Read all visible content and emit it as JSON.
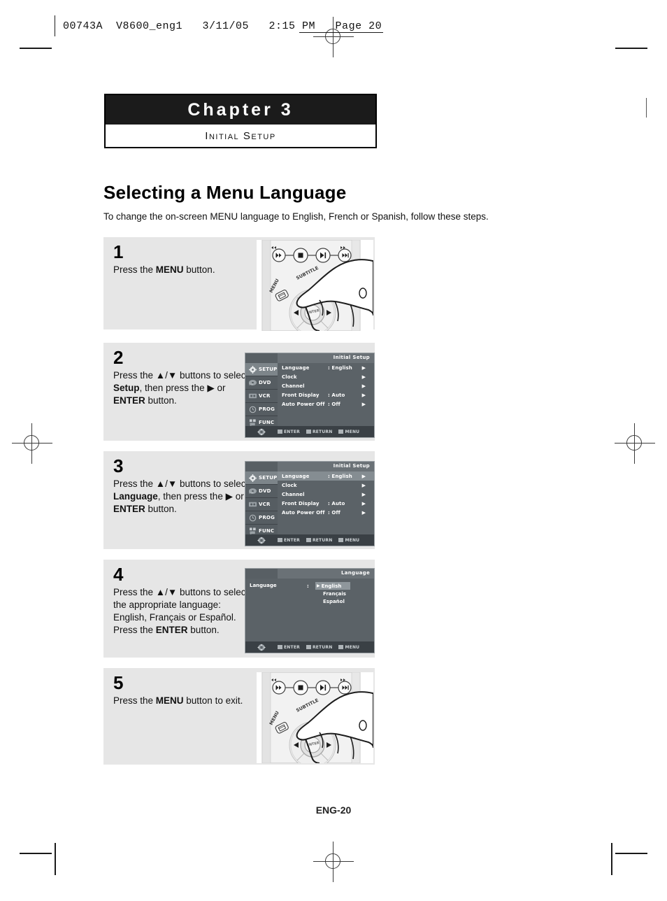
{
  "page": {
    "slug": "00743A  V8600_eng1   3/11/05   2:15 PM   Page 20",
    "footer": "ENG-20"
  },
  "chapter": {
    "title": "Chapter 3",
    "subtitle": "Initial Setup"
  },
  "section": {
    "title": "Selecting a Menu Language",
    "intro": "To change the on-screen MENU language to English, French or Spanish, follow these steps."
  },
  "steps": [
    {
      "number": "1",
      "text_html": "Press the <b>MENU</b> button.",
      "graphic": "remote"
    },
    {
      "number": "2",
      "text_html": "Press the ▲/▼ buttons to select <b>Setup</b>, then press the ▶ or <b>ENTER</b> button.",
      "graphic": "osd-setup"
    },
    {
      "number": "3",
      "text_html": "Press the ▲/▼ buttons to select <b>Language</b>, then press the ▶ or <b>ENTER</b> button.",
      "graphic": "osd-setup-highlight"
    },
    {
      "number": "4",
      "text_html": "Press the ▲/▼ buttons to select the appropriate language: English, Français or Español.<br>Press the <b>ENTER</b> button.",
      "graphic": "osd-language"
    },
    {
      "number": "5",
      "text_html": "Press the <b>MENU</b> button to exit.",
      "graphic": "remote"
    }
  ],
  "osd": {
    "title": "Initial Setup",
    "language_title": "Language",
    "tabs": [
      {
        "label": "SETUP",
        "icon": "gear-icon",
        "selected": true
      },
      {
        "label": "DVD",
        "icon": "disc-icon",
        "selected": false
      },
      {
        "label": "VCR",
        "icon": "cassette-icon",
        "selected": false
      },
      {
        "label": "PROG",
        "icon": "clock-icon",
        "selected": false
      },
      {
        "label": "FUNC",
        "icon": "function-icon",
        "selected": false
      }
    ],
    "rows": [
      {
        "label": "Language",
        "value": ": English",
        "arrow": "▶"
      },
      {
        "label": "Clock",
        "value": "",
        "arrow": "▶"
      },
      {
        "label": "Channel",
        "value": "",
        "arrow": "▶"
      },
      {
        "label": "Front Display",
        "value": ": Auto",
        "arrow": "▶"
      },
      {
        "label": "Auto Power Off",
        "value": ": Off",
        "arrow": "▶"
      }
    ],
    "language_label": "Language",
    "language_colon": ":",
    "language_options": [
      {
        "label": "English",
        "selected": true
      },
      {
        "label": "Français",
        "selected": false
      },
      {
        "label": "Español",
        "selected": false
      }
    ],
    "hints": [
      {
        "label": "ENTER"
      },
      {
        "label": "RETURN"
      },
      {
        "label": "MENU"
      }
    ]
  },
  "remote": {
    "menu_label": "MENU",
    "subtitle_label": "SUBTITLE",
    "enter_label": "ENTER",
    "skip_back_label": "◀◀",
    "skip_fwd_label": "▶▶"
  },
  "colors": {
    "chapter_bar": "#1b1b1b",
    "step_bg": "#e6e6e6",
    "osd_bg": "#4e5459",
    "osd_panel": "#5b6267",
    "osd_highlight": "#858d92",
    "osd_bottombar": "#3a4045"
  }
}
